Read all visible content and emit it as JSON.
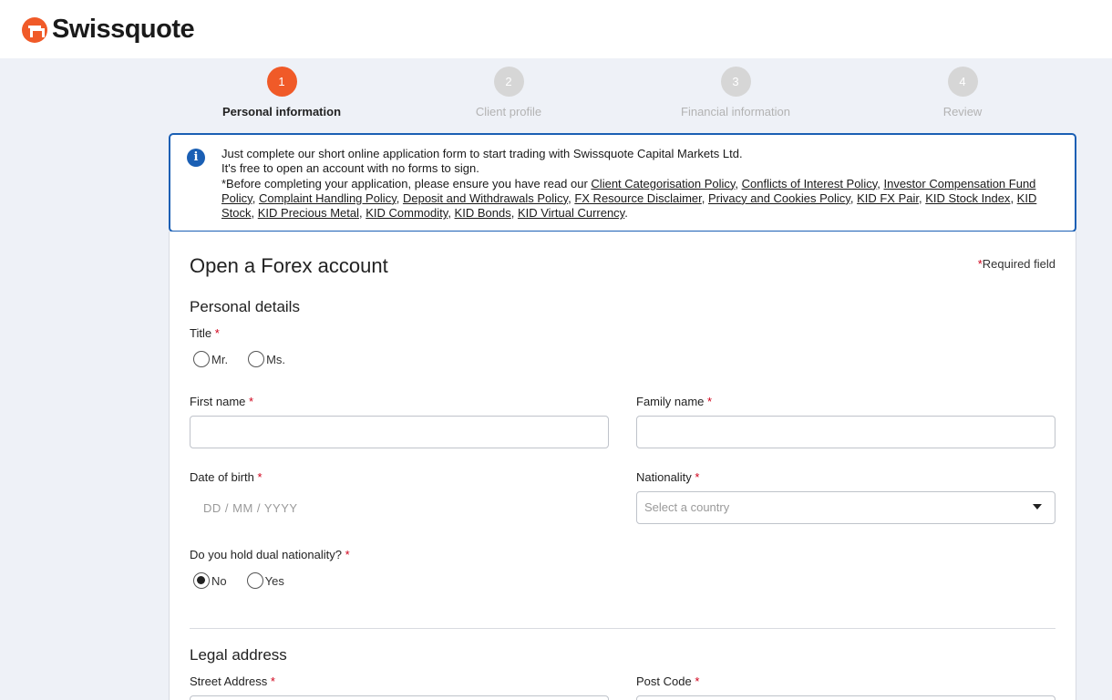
{
  "brand": {
    "name": "Swissquote",
    "accent": "#f05a28"
  },
  "steps": [
    {
      "number": "1",
      "label": "Personal information",
      "active": true
    },
    {
      "number": "2",
      "label": "Client profile",
      "active": false
    },
    {
      "number": "3",
      "label": "Financial information",
      "active": false
    },
    {
      "number": "4",
      "label": "Review",
      "active": false
    }
  ],
  "info": {
    "icon": "info-icon",
    "line1": "Just complete our short online application form to start trading with Swissquote Capital Markets Ltd.",
    "line2": "It's free to open an account with no forms to sign.",
    "line3_prefix": "*Before completing your application, please ensure you have read our ",
    "links": [
      "Client Categorisation Policy",
      "Conflicts of Interest Policy",
      "Investor Compensation Fund Policy",
      "Complaint Handling Policy",
      "Deposit and Withdrawals Policy",
      "FX Resource Disclaimer",
      "Privacy and Cookies Policy",
      "KID FX Pair",
      "KID Stock Index",
      "KID Stock",
      "KID Precious Metal",
      "KID Commodity",
      "KID Bonds",
      "KID Virtual Currency"
    ]
  },
  "form": {
    "title": "Open a Forex account",
    "required_star": "*",
    "required_note": "Required field",
    "personal_details": "Personal details",
    "title_label": "Title",
    "title_options": [
      "Mr.",
      "Ms."
    ],
    "first_name_label": "First name",
    "first_name_value": "",
    "family_name_label": "Family name",
    "family_name_value": "",
    "dob_label": "Date of birth",
    "dob_placeholder": "DD / MM / YYYY",
    "nationality_label": "Nationality",
    "nationality_placeholder": "Select a country",
    "dual_label": "Do you hold dual nationality?",
    "dual_options": [
      "No",
      "Yes"
    ],
    "dual_selected": "No",
    "legal_address": "Legal address",
    "street_label": "Street Address",
    "postcode_label": "Post Code"
  }
}
